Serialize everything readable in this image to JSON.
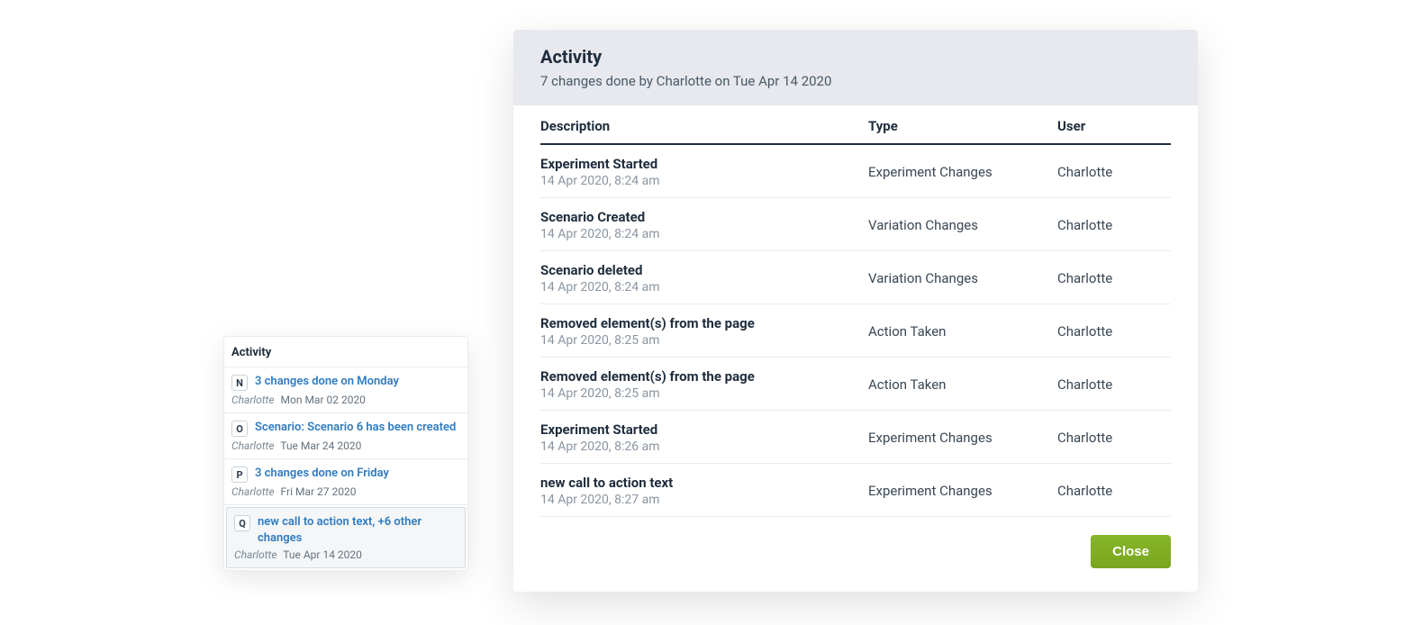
{
  "sidebar": {
    "title": "Activity",
    "items": [
      {
        "badge": "N",
        "title": "3 changes done on Monday",
        "user": "Charlotte",
        "date": "Mon Mar 02 2020",
        "selected": false
      },
      {
        "badge": "O",
        "title": "Scenario: Scenario 6 has been created",
        "user": "Charlotte",
        "date": "Tue Mar 24 2020",
        "selected": false
      },
      {
        "badge": "P",
        "title": "3 changes done on Friday",
        "user": "Charlotte",
        "date": "Fri Mar 27 2020",
        "selected": false
      },
      {
        "badge": "Q",
        "title": "new call to action text, +6 other changes",
        "user": "Charlotte",
        "date": "Tue Apr 14 2020",
        "selected": true
      }
    ]
  },
  "modal": {
    "title": "Activity",
    "subtitle": "7 changes done by Charlotte on Tue Apr 14 2020",
    "headers": {
      "description": "Description",
      "type": "Type",
      "user": "User"
    },
    "rows": [
      {
        "title": "Experiment Started",
        "time": "14 Apr 2020, 8:24 am",
        "type": "Experiment Changes",
        "user": "Charlotte"
      },
      {
        "title": "Scenario Created",
        "time": "14 Apr 2020, 8:24 am",
        "type": "Variation Changes",
        "user": "Charlotte"
      },
      {
        "title": "Scenario deleted",
        "time": "14 Apr 2020, 8:24 am",
        "type": "Variation Changes",
        "user": "Charlotte"
      },
      {
        "title": "Removed element(s) from the page",
        "time": "14 Apr 2020, 8:25 am",
        "type": "Action Taken",
        "user": "Charlotte"
      },
      {
        "title": "Removed element(s) from the page",
        "time": "14 Apr 2020, 8:25 am",
        "type": "Action Taken",
        "user": "Charlotte"
      },
      {
        "title": "Experiment Started",
        "time": "14 Apr 2020, 8:26 am",
        "type": "Experiment Changes",
        "user": "Charlotte"
      },
      {
        "title": "new call to action text",
        "time": "14 Apr 2020, 8:27 am",
        "type": "Experiment Changes",
        "user": "Charlotte"
      }
    ],
    "close_label": "Close"
  }
}
